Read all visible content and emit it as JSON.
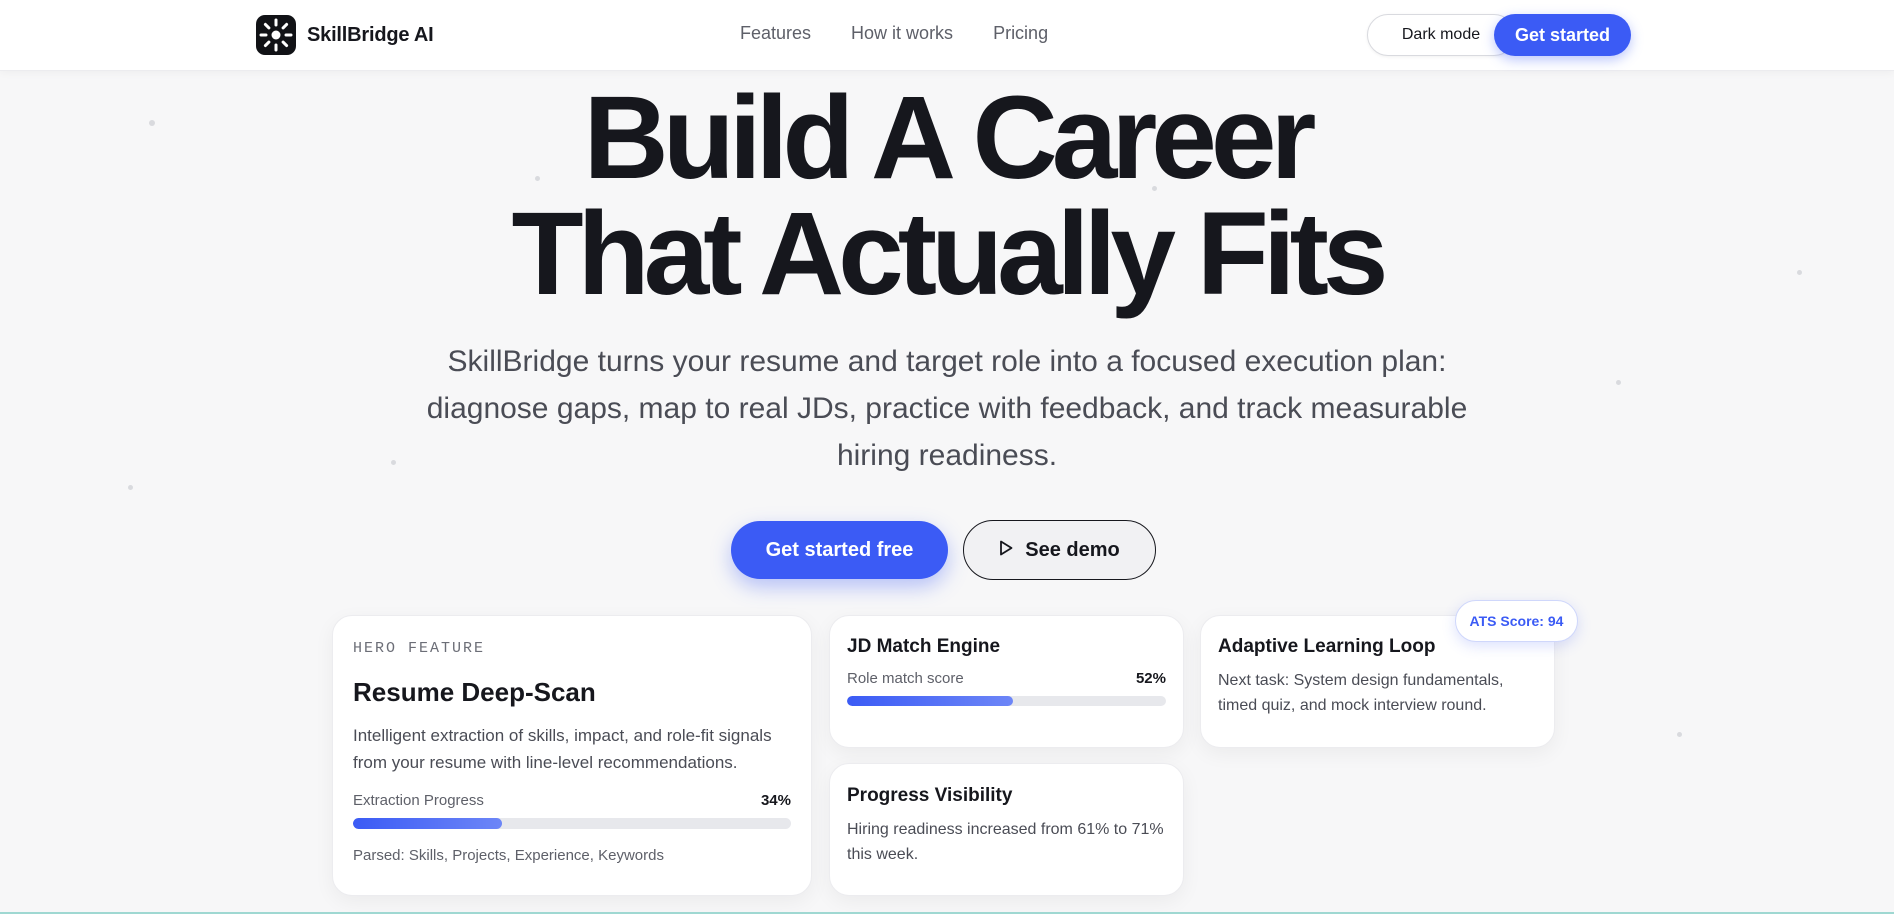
{
  "colors": {
    "accent": "#3b5bf5",
    "text": "#16171d",
    "muted": "#5e6069",
    "background": "#f7f7f8"
  },
  "nav": {
    "brand": "SkillBridge AI",
    "logo_icon": "sunburst-icon",
    "links": [
      "Features",
      "How it works",
      "Pricing"
    ],
    "dark_mode_label": "Dark mode",
    "get_started_label": "Get started"
  },
  "hero": {
    "title_line1": "Build A Career",
    "title_line2": "That Actually Fits",
    "subtitle": "SkillBridge turns your resume and target role into a focused execution plan: diagnose gaps, map to real JDs, practice with feedback, and track measurable hiring readiness.",
    "cta_primary": "Get started free",
    "cta_demo": "See demo",
    "cta_demo_icon": "play-icon"
  },
  "cards": {
    "hero_feature": {
      "eyebrow": "HERO FEATURE",
      "title": "Resume Deep-Scan",
      "description": "Intelligent extraction of skills, impact, and role-fit signals from your resume with line-level recommendations.",
      "progress_label": "Extraction Progress",
      "progress_text": "34%",
      "progress_value": 34,
      "parsed": "Parsed: Skills, Projects, Experience, Keywords"
    },
    "jd_match": {
      "title": "JD Match Engine",
      "label": "Role match score",
      "value_text": "52%",
      "value": 52
    },
    "adaptive": {
      "title": "Adaptive Learning Loop",
      "description": "Next task: System design fundamentals, timed quiz, and mock interview round."
    },
    "progress_visibility": {
      "title": "Progress Visibility",
      "description": "Hiring readiness increased from 61% to 71% this week."
    },
    "ats_badge": "ATS Score: 94"
  }
}
